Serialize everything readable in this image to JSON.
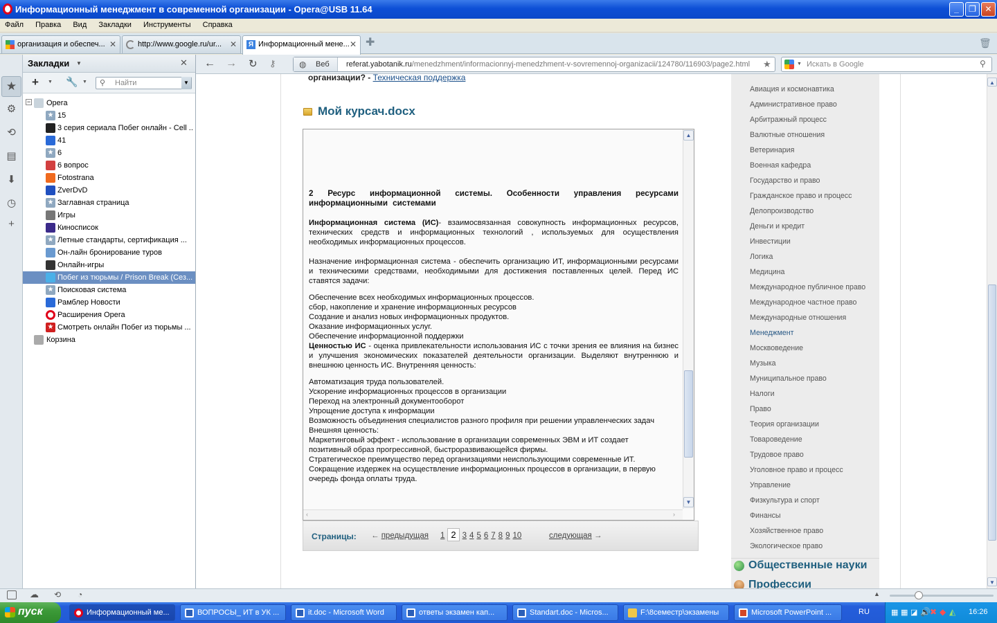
{
  "window": {
    "title": "Информационный менеджмент в современной организации - Opera@USB 11.64"
  },
  "menu": [
    "Файл",
    "Правка",
    "Вид",
    "Закладки",
    "Инструменты",
    "Справка"
  ],
  "tabs": [
    {
      "label": "организация и обеспеч...",
      "close": "✕"
    },
    {
      "label": "http://www.google.ru/ur...",
      "close": "✕"
    },
    {
      "label": "Информационный мене...",
      "close": "✕"
    }
  ],
  "panel": {
    "title": "Закладки",
    "search_placeholder": "Найти",
    "bookmarks": [
      {
        "label": "Opera",
        "kind": "folder"
      },
      {
        "label": "15"
      },
      {
        "label": "3 серия сериала Побег онлайн - Cell ..."
      },
      {
        "label": "41"
      },
      {
        "label": "6"
      },
      {
        "label": "6 вопрос"
      },
      {
        "label": "Fotostrana"
      },
      {
        "label": "ZverDvD"
      },
      {
        "label": "Заглавная страница"
      },
      {
        "label": "Игры"
      },
      {
        "label": "Киносписок"
      },
      {
        "label": "Летные стандарты, сертификация ..."
      },
      {
        "label": "Он-лайн бронирование туров"
      },
      {
        "label": "Онлайн-игры"
      },
      {
        "label": "Побег из тюрьмы / Prison Break (Сез..."
      },
      {
        "label": "Поисковая система"
      },
      {
        "label": "Рамблер Новости"
      },
      {
        "label": "Расширения Opera"
      },
      {
        "label": "Смотреть онлайн Побег из тюрьмы ..."
      },
      {
        "label": "Корзина",
        "kind": "trash"
      }
    ]
  },
  "nav": {
    "security_label": "Веб",
    "url_domain": "referat.yabotanik.ru",
    "url_path": "/menedzhment/informacionnyj-menedzhment-v-sovremennoj-organizacii/124780/116903/page2.html",
    "search_placeholder": "Искать в Google"
  },
  "page": {
    "top_text": "организации? -",
    "top_link": "Техническая поддержка",
    "doc_title": "Мой курсач.docx",
    "doc": {
      "heading": "2 Ресурс информационной системы. Особенности управления ресурсами информационными системами",
      "p1_bold": "Информационная система (ИС)",
      "p1_rest": "- взаимосвязанная совокупность информационных ресурсов, технических средств и информационных технологий , используемых для осуществления необходимых информационных процессов.",
      "p2": "Назначение информационная система - обеспечить организацию ИТ, информационными ресурсами и техническими средствами, необходимыми для достижения поставленных целей. Перед ИС ставятся задачи:",
      "tasks": [
        "Обеспечение всех необходимых информационных процессов.",
        "сбор, накопление и хранение информационных ресурсов",
        "Создание и анализ новых информационных продуктов.",
        "Оказание информационных услуг.",
        "Обеспечение информационной поддержки"
      ],
      "p3_bold": "Ценностью ИС",
      "p3_rest": " - оценка привлекательности использования ИС с точки зрения ее влияния на бизнес и улучшения экономических показателей деятельности организации. Выделяют внутреннюю и внешнюю ценность ИС. Внутренняя ценность:",
      "values": [
        "Автоматизация труда пользователей.",
        "Ускорение информационных процессов в организации",
        "Переход на электронный документооборот",
        "Упрощение доступа к информации",
        "Возможность объединения специалистов разного профиля при решении управленческих задач",
        "Внешняя ценность:",
        "Маркетинговый эффект - использование в организации современных ЭВМ и ИТ создает позитивный образ прогрессивной, быстроразвивающейся фирмы.",
        "Стратегическое преимущество перед организациями неиспользующими современные ИТ.",
        "Сокращение издержек на осуществление информационных процессов в организации, в первую",
        "очередь фонда оплаты труда."
      ]
    },
    "pager": {
      "label": "Страницы:",
      "prev": "предыдущая",
      "next": "следующая",
      "pages": [
        "1",
        "2",
        "3",
        "4",
        "5",
        "6",
        "7",
        "8",
        "9",
        "10"
      ],
      "current": "2"
    }
  },
  "sidebar": {
    "categories": [
      "Авиация и космонавтика",
      "Административное право",
      "Арбитражный процесс",
      "Валютные отношения",
      "Ветеринария",
      "Военная кафедра",
      "Государство и право",
      "Гражданское право и процесс",
      "Делопроизводство",
      "Деньги и кредит",
      "Инвестиции",
      "Логика",
      "Медицина",
      "Международное публичное право",
      "Международное частное право",
      "Международные отношения",
      "Менеджмент",
      "Москвоведение",
      "Музыка",
      "Муниципальное право",
      "Налоги",
      "Право",
      "Теория организации",
      "Товароведение",
      "Трудовое право",
      "Уголовное право и процесс",
      "Управление",
      "Физкультура и спорт",
      "Финансы",
      "Хозяйственное право",
      "Экологическое право"
    ],
    "active": "Менеджмент",
    "section1": "Общественные науки",
    "section2": "Профессии"
  },
  "taskbar": {
    "start": "пуск",
    "tasks": [
      "Информационный ме...",
      "ВОПРОСЫ_ ИТ в УК ...",
      "it.doc - Microsoft Word",
      "ответы экзамен кап...",
      "Standart.doc - Micros...",
      "F:\\8семестр\\экзамены",
      "Microsoft PowerPoint ..."
    ],
    "lang": "RU",
    "clock": "16:26"
  },
  "colors": {
    "title_blue": "#0d4fd6",
    "link": "#1a4f8a",
    "heading_teal": "#1f5f7f",
    "selection": "#6b8fc2"
  }
}
